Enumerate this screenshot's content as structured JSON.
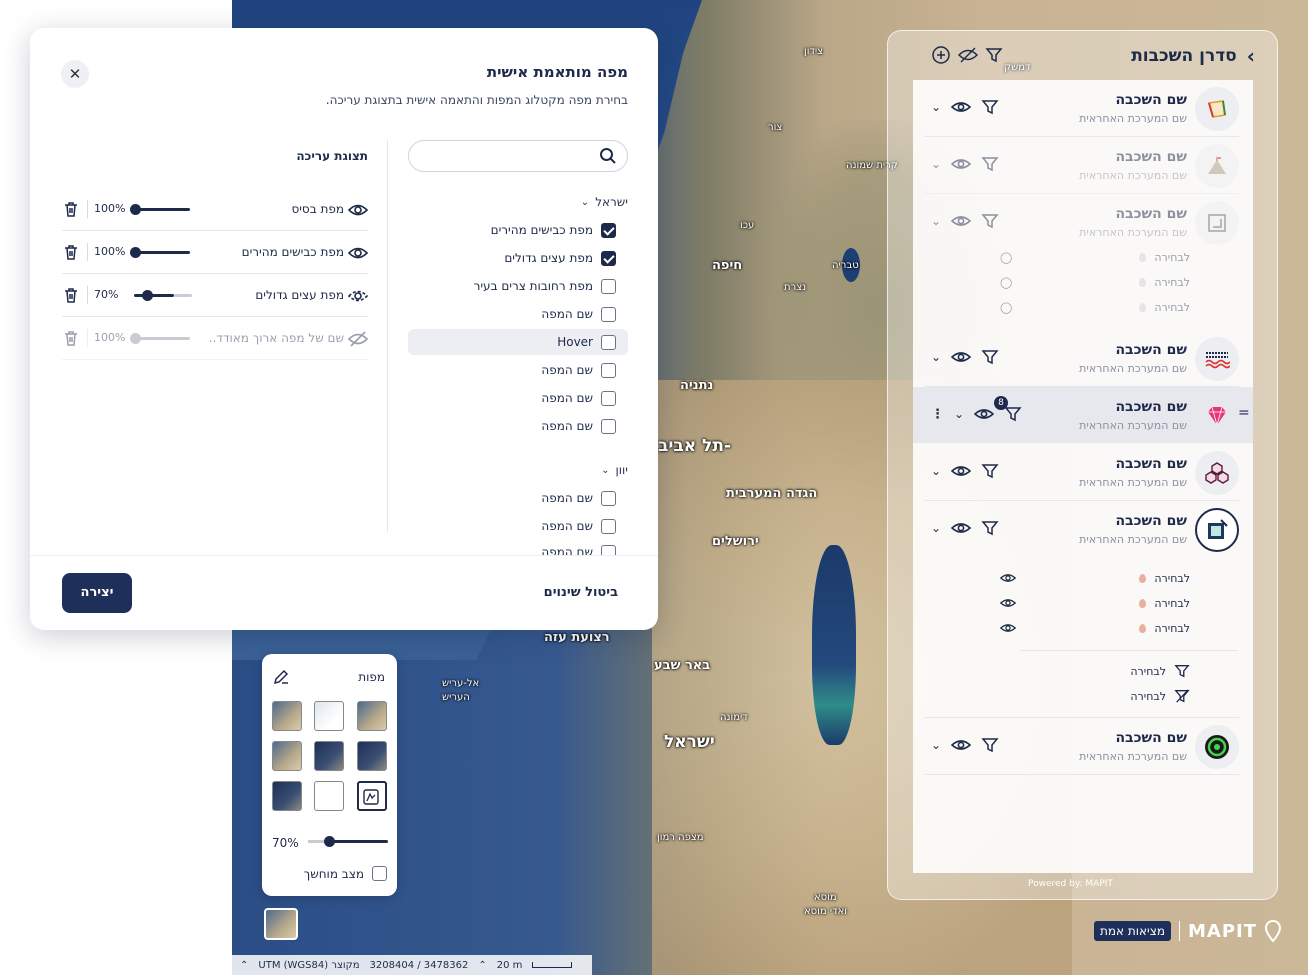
{
  "map": {
    "labels": [
      {
        "text": "צידון"
      },
      {
        "text": "צור"
      },
      {
        "text": "עכו"
      },
      {
        "text": "חיפה"
      },
      {
        "text": "טבריה"
      },
      {
        "text": "נצרת"
      },
      {
        "text": "נתניה"
      },
      {
        "text": "תל אביב-"
      },
      {
        "text": "הגדה המערבית"
      },
      {
        "text": "ירושלים"
      },
      {
        "text": "רצועת עזה"
      },
      {
        "text": "באר שבע"
      },
      {
        "text": "דימונה"
      },
      {
        "text": "ישראל"
      },
      {
        "text": "מצפה רמון"
      },
      {
        "text": "אל-עריש"
      },
      {
        "text": "העריש"
      },
      {
        "text": "דמשק"
      },
      {
        "text": "קרית שמונה"
      },
      {
        "text": "מוסא"
      },
      {
        "text": "ואדי מוסא"
      }
    ]
  },
  "modal": {
    "title": "מפה מותאמת אישית",
    "subtitle": "בחירת מפה מקטלוג המפות והתאמה אישית בתצוגת עריכה.",
    "search_placeholder": "",
    "groups": [
      {
        "name": "ישראל",
        "items": [
          {
            "label": "מפת כבישים מהירים",
            "checked": true
          },
          {
            "label": "מפת עצים גדולים",
            "checked": true
          },
          {
            "label": "מפת רחובות צרים בעיר",
            "checked": false
          },
          {
            "label": "שם המפה",
            "checked": false
          },
          {
            "label": "Hover",
            "checked": false
          },
          {
            "label": "שם המפה",
            "checked": false
          },
          {
            "label": "שם המפה",
            "checked": false
          },
          {
            "label": "שם המפה",
            "checked": false
          }
        ]
      },
      {
        "name": "יוון",
        "items": [
          {
            "label": "שם המפה",
            "checked": false
          },
          {
            "label": "שם המפה",
            "checked": false
          },
          {
            "label": "שם המפה",
            "checked": false
          }
        ]
      }
    ],
    "edit_title": "תצוגת עריכה",
    "edit_rows": [
      {
        "name": "מפת בסיס",
        "opacity": "100%",
        "value": 1.0
      },
      {
        "name": "מפת כבישים מהירים",
        "opacity": "100%",
        "value": 1.0
      },
      {
        "name": "מפת עצים גדולים",
        "opacity": "70%",
        "value": 0.7
      },
      {
        "name": "שם של מפה ארוך מאודד..",
        "opacity": "100%",
        "value": 1.0
      }
    ],
    "create_label": "יצירה",
    "cancel_label": "ביטול שינוים"
  },
  "layers": {
    "title": "סדרן השכבות",
    "rows": [
      {
        "name": "שם השכבה",
        "system": "שם המערכת האחראית",
        "icon": "polygon-icon"
      },
      {
        "name": "שם השכבה",
        "system": "שם המערכת האחראית",
        "icon": "tent-icon"
      },
      {
        "name": "שם השכבה",
        "system": "שם המערכת האחראית",
        "icon": "frame-icon"
      },
      {
        "name": "שם השכבה",
        "system": "שם המערכת האחראית",
        "icon": "waves-icon"
      },
      {
        "name": "שם השכבה",
        "system": "שם המערכת האחראית",
        "icon": "gem-icon"
      },
      {
        "name": "שם השכבה",
        "system": "שם המערכת האחראית",
        "icon": "hexagons-icon"
      },
      {
        "name": "שם השכבה",
        "system": "שם המערכת האחראית",
        "icon": "frame-edit-icon"
      },
      {
        "name": "שם השכבה",
        "system": "שם המערכת האחראית",
        "icon": "target-icon"
      }
    ],
    "sub_label": "לבחירה",
    "filter_badge": "8",
    "powered_by": "Powered by: MAPIT"
  },
  "picker": {
    "title": "מפות",
    "opacity": "70%",
    "opacity_value": 0.7,
    "dark_mode_label": "מצב מוחשך"
  },
  "brand": {
    "tag": "מציאות אמת",
    "logo": "MAPIT"
  },
  "status": {
    "scale": "20 m",
    "coords": "3208404 / 3478362",
    "projection": "UTM (WGS84) מקוצר"
  },
  "colors": {
    "primary": "#1e2a4a",
    "accent": "#1e2f5a"
  }
}
